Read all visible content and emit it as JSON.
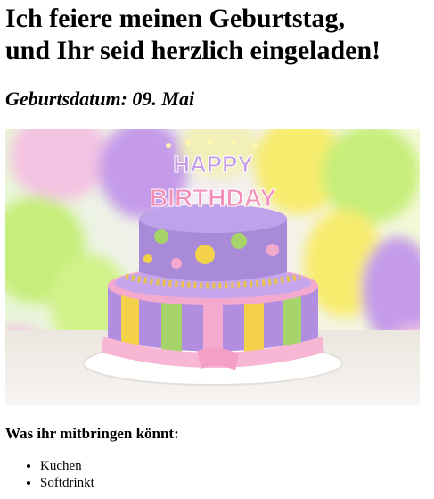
{
  "heading": {
    "line1": "Ich feiere meinen Geburtstag,",
    "line2": "und Ihr seid herzlich eingeladen!"
  },
  "birthdate": "Geburtsdatum: 09. Mai",
  "image": {
    "description_icon": "birthday-cake-image",
    "topper_line1": "HAPPY",
    "topper_line2": "BIRTHDAY",
    "colors": {
      "cake_purple": "#b28ee0",
      "cake_yellow": "#f3d24a",
      "cake_green": "#a6d36a",
      "cake_pink": "#f4a9cf",
      "ribbon": "#f7b6d3",
      "balloon_green": "#c6ee7a",
      "balloon_purple": "#c59be9",
      "balloon_yellow": "#f8ec6e"
    }
  },
  "bring": {
    "title": "Was ihr mitbringen könnt:",
    "items": [
      "Kuchen",
      "Softdrinkt"
    ]
  }
}
